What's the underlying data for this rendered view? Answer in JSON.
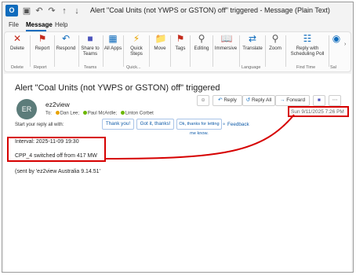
{
  "titlebar": {
    "app_icon_text": "O",
    "title": "Alert \"Coal Units (not YWPS or GSTON) off\" triggered  -  Message (Plain Text)"
  },
  "tabs": [
    {
      "label": "File"
    },
    {
      "label": "Message"
    },
    {
      "label": "Help"
    }
  ],
  "ribbon": {
    "buttons": [
      {
        "label": "Delete",
        "icon": "delete-icon"
      },
      {
        "label": "Report",
        "icon": "report-icon"
      },
      {
        "label": "Respond",
        "icon": "respond-icon"
      },
      {
        "label": "Share to Teams",
        "icon": "teams-icon"
      },
      {
        "label": "All Apps",
        "icon": "apps-icon"
      },
      {
        "label": "Quick Steps",
        "icon": "quick-steps-icon"
      },
      {
        "label": "Move",
        "icon": "move-icon"
      },
      {
        "label": "Tags",
        "icon": "tags-icon"
      },
      {
        "label": "Editing",
        "icon": "editing-icon"
      },
      {
        "label": "Immersive",
        "icon": "immersive-icon"
      },
      {
        "label": "Translate",
        "icon": "translate-icon"
      },
      {
        "label": "Zoom",
        "icon": "zoom-icon"
      },
      {
        "label": "Reply with Scheduling Poll",
        "icon": "scheduling-poll-icon"
      }
    ],
    "groups": [
      "Delete",
      "Report",
      "Teams",
      "Quick...",
      "Language",
      "Find Time",
      "Sal"
    ]
  },
  "message": {
    "subject": "Alert \"Coal Units (not YWPS or GSTON) off\" triggered",
    "avatar_initials": "ER",
    "sender": "ez2view",
    "to_label": "To",
    "recipients": [
      "Dan Lee;",
      "Paul McArdle;",
      "Linton Corbet"
    ],
    "actions": {
      "reply": "Reply",
      "reply_all": "Reply All",
      "forward": "Forward"
    },
    "date": "Sun 9/11/2025 7:26 PM",
    "suggest_label": "Start your reply all with:",
    "suggestions": [
      "Thank you!",
      "Got it, thanks!",
      "Ok, thanks for letting me know."
    ],
    "feedback": "Feedback",
    "body": [
      "Interval: 2025-11-09 19:30",
      "CPP_4 switched off from 417 MW",
      "(sent by 'ez2view Australia 9.14.51'"
    ]
  },
  "colors": {
    "accent": "#0f6cbd",
    "annotation": "#d60000"
  }
}
